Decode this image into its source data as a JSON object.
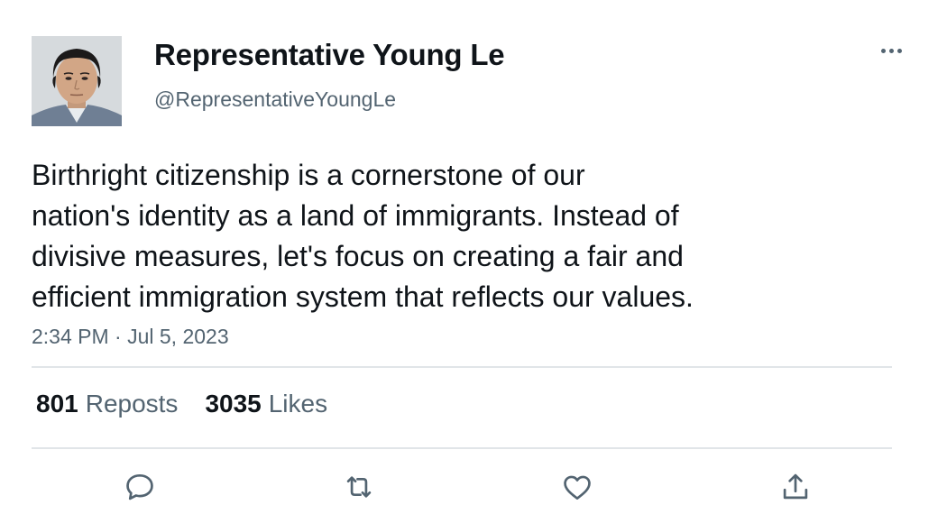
{
  "author": {
    "display_name": "Representative Young Le",
    "handle": "@RepresentativeYoungLe"
  },
  "tweet": {
    "lines": [
      "Birthright citizenship is a cornerstone of our",
      "nation's identity as a land of immigrants. Instead of",
      "divisive measures, let's focus on creating a fair and",
      "efficient immigration system that reflects our values."
    ],
    "timestamp": "2:34 PM · Jul 5, 2023"
  },
  "stats": {
    "reposts_count": "801",
    "reposts_label": "Reposts",
    "likes_count": "3035",
    "likes_label": "Likes"
  },
  "icons": {
    "more": "more-horizontal-icon",
    "reply": "reply-icon",
    "repost": "repost-icon",
    "like": "heart-icon",
    "share": "share-icon"
  },
  "colors": {
    "text_primary": "#0f1419",
    "text_secondary": "#536471",
    "divider": "#e1e5e8"
  }
}
